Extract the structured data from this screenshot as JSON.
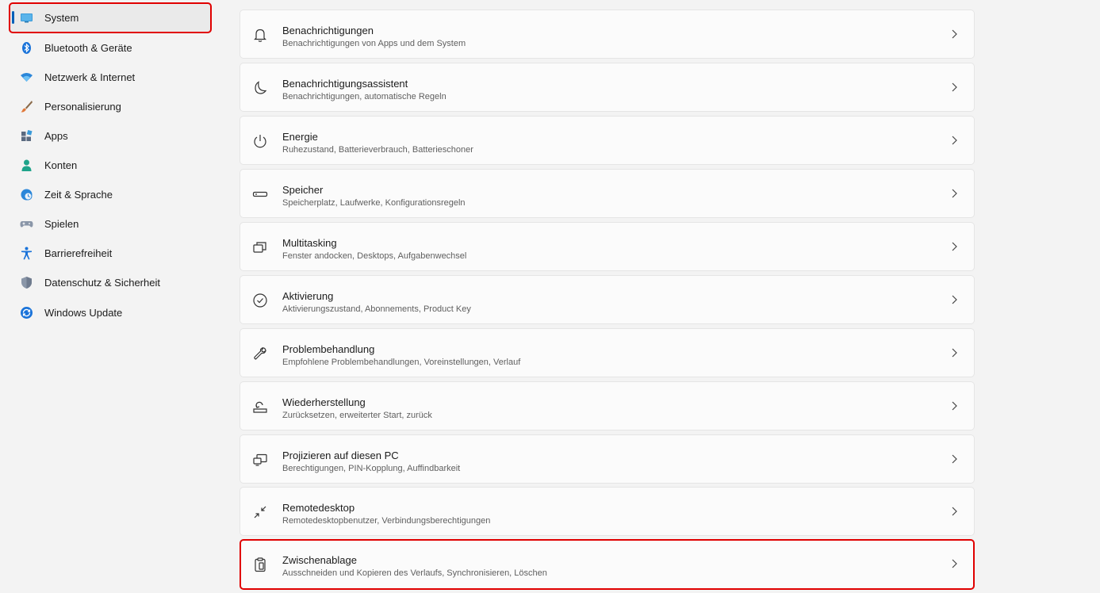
{
  "sidebar": {
    "items": [
      {
        "label": "System",
        "icon": "monitor-icon"
      },
      {
        "label": "Bluetooth & Geräte",
        "icon": "bluetooth-icon"
      },
      {
        "label": "Netzwerk & Internet",
        "icon": "wifi-icon"
      },
      {
        "label": "Personalisierung",
        "icon": "brush-icon"
      },
      {
        "label": "Apps",
        "icon": "apps-icon"
      },
      {
        "label": "Konten",
        "icon": "person-icon"
      },
      {
        "label": "Zeit & Sprache",
        "icon": "globe-clock-icon"
      },
      {
        "label": "Spielen",
        "icon": "gamepad-icon"
      },
      {
        "label": "Barrierefreiheit",
        "icon": "accessibility-icon"
      },
      {
        "label": "Datenschutz & Sicherheit",
        "icon": "shield-icon"
      },
      {
        "label": "Windows Update",
        "icon": "update-icon"
      }
    ]
  },
  "settings": {
    "items": [
      {
        "title": "Benachrichtigungen",
        "description": "Benachrichtigungen von Apps und dem System",
        "icon": "bell-icon"
      },
      {
        "title": "Benachrichtigungsassistent",
        "description": "Benachrichtigungen, automatische Regeln",
        "icon": "moon-icon"
      },
      {
        "title": "Energie",
        "description": "Ruhezustand, Batterieverbrauch, Batterieschoner",
        "icon": "power-icon"
      },
      {
        "title": "Speicher",
        "description": "Speicherplatz, Laufwerke, Konfigurationsregeln",
        "icon": "storage-icon"
      },
      {
        "title": "Multitasking",
        "description": "Fenster andocken, Desktops, Aufgabenwechsel",
        "icon": "multitasking-icon"
      },
      {
        "title": "Aktivierung",
        "description": "Aktivierungszustand, Abonnements, Product Key",
        "icon": "check-circle-icon"
      },
      {
        "title": "Problembehandlung",
        "description": "Empfohlene Problembehandlungen, Voreinstellungen, Verlauf",
        "icon": "wrench-icon"
      },
      {
        "title": "Wiederherstellung",
        "description": "Zurücksetzen, erweiterter Start, zurück",
        "icon": "recovery-icon"
      },
      {
        "title": "Projizieren auf diesen PC",
        "description": "Berechtigungen, PIN-Kopplung, Auffindbarkeit",
        "icon": "project-icon"
      },
      {
        "title": "Remotedesktop",
        "description": "Remotedesktopbenutzer, Verbindungsberechtigungen",
        "icon": "remote-desktop-icon"
      },
      {
        "title": "Zwischenablage",
        "description": "Ausschneiden und Kopieren des Verlaufs, Synchronisieren, Löschen",
        "icon": "clipboard-icon"
      }
    ]
  },
  "colors": {
    "accent": "#005fb8",
    "highlight": "#e00000",
    "background": "#f3f3f3",
    "card": "#fbfbfb"
  }
}
